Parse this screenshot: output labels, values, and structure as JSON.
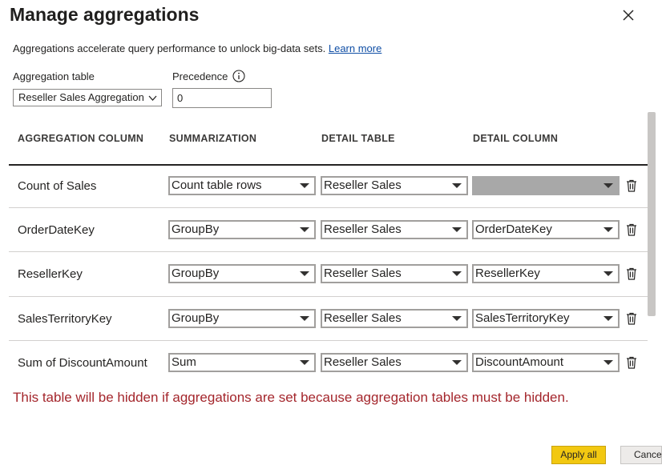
{
  "dialog": {
    "title": "Manage aggregations",
    "description": "Aggregations accelerate query performance to unlock big-data sets.",
    "learn_more": "Learn more"
  },
  "aggregation_table": {
    "label": "Aggregation table",
    "value": "Reseller Sales Aggregation"
  },
  "precedence": {
    "label": "Precedence",
    "value": "0"
  },
  "columns": {
    "aggregation_column": "AGGREGATION COLUMN",
    "summarization": "SUMMARIZATION",
    "detail_table": "DETAIL TABLE",
    "detail_column": "DETAIL COLUMN"
  },
  "rows": [
    {
      "name": "Count of Sales",
      "summarization": "Count table rows",
      "detail_table": "Reseller Sales",
      "detail_column": ""
    },
    {
      "name": "OrderDateKey",
      "summarization": "GroupBy",
      "detail_table": "Reseller Sales",
      "detail_column": "OrderDateKey"
    },
    {
      "name": "ResellerKey",
      "summarization": "GroupBy",
      "detail_table": "Reseller Sales",
      "detail_column": "ResellerKey"
    },
    {
      "name": "SalesTerritoryKey",
      "summarization": "GroupBy",
      "detail_table": "Reseller Sales",
      "detail_column": "SalesTerritoryKey"
    },
    {
      "name": "Sum of DiscountAmount",
      "summarization": "Sum",
      "detail_table": "Reseller Sales",
      "detail_column": "DiscountAmount"
    }
  ],
  "warning": "This table will be hidden if aggregations are set because aggregation tables must be hidden.",
  "buttons": {
    "apply_all": "Apply all",
    "cancel": "Cancel"
  },
  "icons": {
    "close": "close-icon",
    "info": "info-icon",
    "chevron": "chevron-down-icon",
    "delete": "trash-icon"
  },
  "colors": {
    "warning": "#a4262c",
    "apply": "#f2c811",
    "link": "#0f4ea5"
  }
}
